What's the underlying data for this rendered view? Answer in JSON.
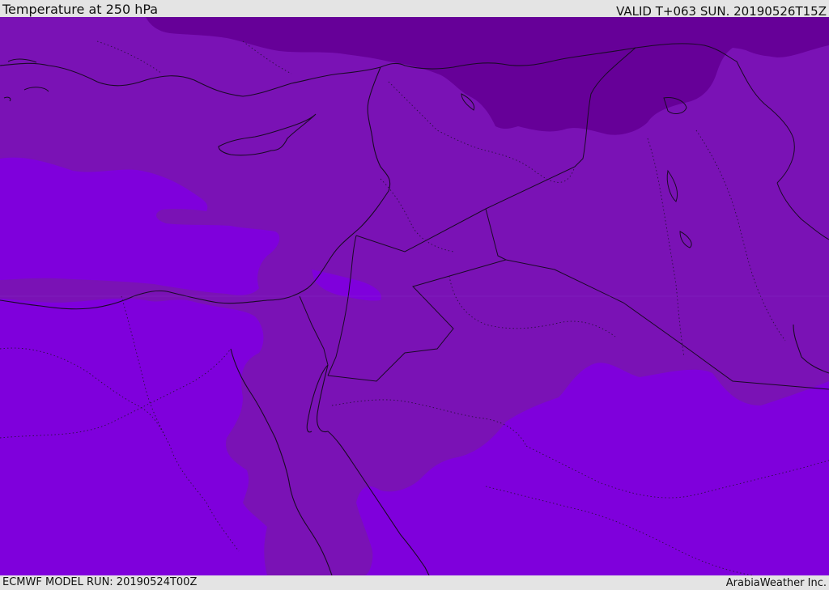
{
  "header": {
    "title": "Temperature at 250 hPa",
    "valid": "VALID T+063 SUN. 20190526T15Z"
  },
  "footer": {
    "model_run": "ECMWF MODEL RUN: 20190524T00Z",
    "credit": "ArabiaWeather Inc."
  },
  "map": {
    "field": "temperature-250hPa",
    "colors": {
      "warm_band": "#7f00dc",
      "mid_band": "#7a12b5",
      "cold_band": "#660098",
      "coastline": "#1a0a26"
    }
  }
}
